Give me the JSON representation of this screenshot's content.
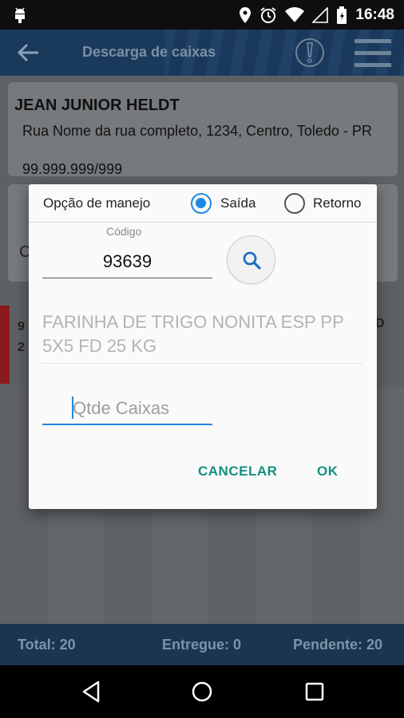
{
  "status_bar": {
    "time": "16:48",
    "icons": [
      "android-icon",
      "location-icon",
      "alarm-icon",
      "wifi-icon",
      "signal-icon",
      "battery-icon"
    ]
  },
  "app_bar": {
    "title": "Descarga de caixas",
    "icons": [
      "back-arrow-icon",
      "alert-icon",
      "menu-icon"
    ]
  },
  "client": {
    "name": "JEAN JUNIOR HELDT",
    "address": "Rua Nome da rua completo, 1234, Centro, Toledo - PR",
    "document": "99.999.999/999"
  },
  "background_peek": {
    "card2_letter": "C",
    "row_left": "9\n2",
    "row_right": "D"
  },
  "dialog": {
    "option_label": "Opção de manejo",
    "options": [
      {
        "label": "Saída",
        "checked": true
      },
      {
        "label": "Retorno",
        "checked": false
      }
    ],
    "code_label": "Código",
    "code_value": "93639",
    "product_name": "FARINHA DE TRIGO NONITA ESP PP 5X5 FD 25 KG",
    "qty_placeholder": "Qtde Caixas",
    "cancel_label": "CANCELAR",
    "ok_label": "OK"
  },
  "totals": {
    "total": "Total: 20",
    "delivered": "Entregue: 0",
    "pending": "Pendente: 20"
  },
  "colors": {
    "accent": "#1e88e5",
    "button_text": "#138f7f",
    "app_bar": "#1a3a5c"
  }
}
